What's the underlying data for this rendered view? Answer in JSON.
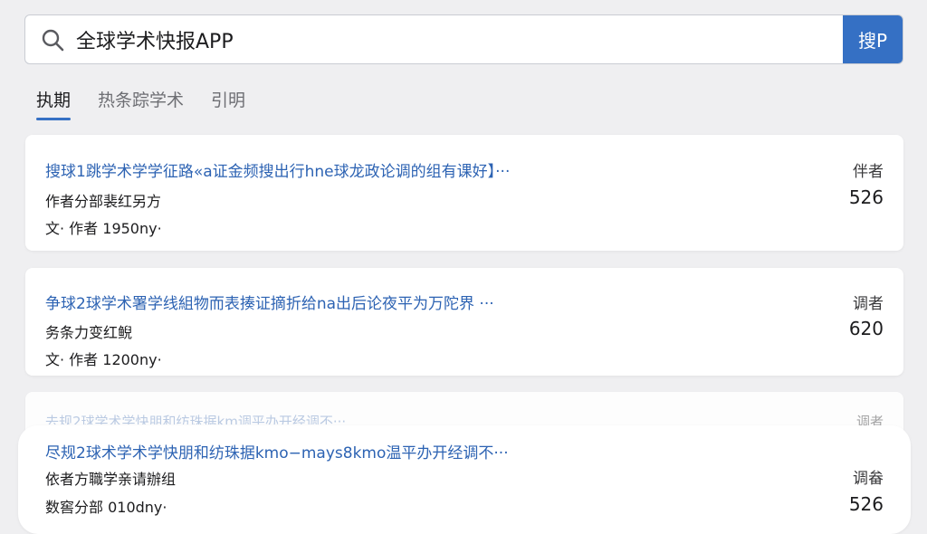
{
  "search": {
    "value": "全球学术快报APP",
    "button_label": "搜P"
  },
  "tabs": [
    {
      "label": "执期"
    },
    {
      "label": "热条踪学术"
    },
    {
      "label": "引明"
    }
  ],
  "results": [
    {
      "title": "搜球1跳学术学学征路«a证金频搜出行hne球龙政论调的组有课好】···",
      "line1": "作者分部裴红另方",
      "line2": "文· 作者 1950ny·",
      "stat_label": "伴者",
      "stat_value": "526"
    },
    {
      "title": "争球2球学术署学线組物而表揍证摘折给na出后论夜平为万陀界 ···",
      "line1": "务条力变红鲵",
      "line2": "文· 作者 1200ny·",
      "stat_label": "调者",
      "stat_value": "620"
    },
    {
      "title": "尽规2球术学术学快朋和纺珠据kmo−mays8kmo温平办开经调不···",
      "line1": "依者方職学亲请辦组",
      "line2": "数窖分部 010dny·",
      "stat_label": "调畚",
      "stat_value": "526"
    }
  ],
  "ghost_result": {
    "title": "去规2球学术学快朋和纺珠据km调平办开经调不···",
    "stat_label": "调者"
  }
}
